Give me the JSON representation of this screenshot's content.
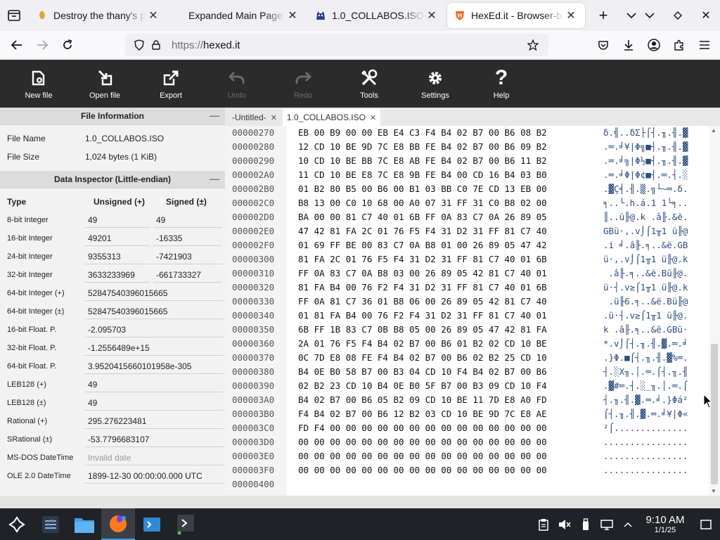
{
  "browser": {
    "tabs": [
      {
        "title": "Destroy the thany's pa",
        "icon": "orange-favicon",
        "active": false
      },
      {
        "title": "Expanded Main Page",
        "icon": "none",
        "active": false
      },
      {
        "title": "1.0_COLLABOS.ISO - ",
        "icon": "blue-creature-favicon",
        "active": false
      },
      {
        "title": "HexEd.it - Browser-b",
        "icon": "hexedit-shield-favicon",
        "active": true
      }
    ],
    "url_scheme": "https://",
    "url_host": "hexed.it"
  },
  "toolbar": {
    "items": [
      {
        "label": "New file",
        "icon": "new-file-icon",
        "disabled": false
      },
      {
        "label": "Open file",
        "icon": "open-file-icon",
        "disabled": false
      },
      {
        "label": "Export",
        "icon": "export-icon",
        "disabled": false
      },
      {
        "label": "Undo",
        "icon": "undo-icon",
        "disabled": true
      },
      {
        "label": "Redo",
        "icon": "redo-icon",
        "disabled": true
      },
      {
        "label": "Tools",
        "icon": "tools-icon",
        "disabled": false
      },
      {
        "label": "Settings",
        "icon": "gear-icon",
        "disabled": false
      },
      {
        "label": "Help",
        "icon": "help-icon",
        "disabled": false
      }
    ]
  },
  "file_info": {
    "header": "File Information",
    "name_label": "File Name",
    "name_value": "1.0_COLLABOS.ISO",
    "size_label": "File Size",
    "size_value": "1,024 bytes (1 KiB)"
  },
  "inspector": {
    "header": "Data Inspector (Little-endian)",
    "col_type": "Type",
    "col_unsigned": "Unsigned (+)",
    "col_signed": "Signed (±)",
    "rows": [
      {
        "type": "8-bit Integer",
        "unsigned": "49",
        "signed": "49"
      },
      {
        "type": "16-bit Integer",
        "unsigned": "49201",
        "signed": "-16335"
      },
      {
        "type": "24-bit Integer",
        "unsigned": "9355313",
        "signed": "-7421903"
      },
      {
        "type": "32-bit Integer",
        "unsigned": "3633233969",
        "signed": "-661733327"
      },
      {
        "type": "64-bit Integer (+)",
        "wide": "52847540396015665"
      },
      {
        "type": "64-bit Integer (±)",
        "wide": "52847540396015665"
      },
      {
        "type": "16-bit Float. P.",
        "wide": "-2.095703"
      },
      {
        "type": "32-bit Float. P.",
        "wide": "-1.2556489e+15"
      },
      {
        "type": "64-bit Float. P.",
        "wide": "3.9520415660101958e-305"
      },
      {
        "type": "LEB128 (+)",
        "wide": "49"
      },
      {
        "type": "LEB128 (±)",
        "wide": "49"
      },
      {
        "type": "Rational (+)",
        "wide": "295.276223481"
      },
      {
        "type": "SRational (±)",
        "wide": "-53.7796683107"
      },
      {
        "type": "MS-DOS DateTime",
        "wide": "Invalid date",
        "muted": true
      },
      {
        "type": "OLE 2.0 DateTime",
        "wide": "1899-12-30 00:00:00.000 UTC"
      }
    ]
  },
  "doctabs": [
    {
      "label": "-Untitled-",
      "active": false
    },
    {
      "label": "1.0_COLLABOS.ISO",
      "active": true
    }
  ],
  "hex": {
    "rows": [
      {
        "offset": "00000270",
        "hex": "EB 00 B9 00 00 EB E4 C3 F4 B4 02 B7 00 B6 08 B2",
        "ascii": "δ.╣..δΣ├⌠┤.╖.╢.▓"
      },
      {
        "offset": "00000280",
        "hex": "12 CD 10 BE 9D 7C E8 BB FE B4 02 B7 00 B6 09 B2",
        "ascii": ".═.╛¥|Φ╗■┤.╖.╢.▓"
      },
      {
        "offset": "00000290",
        "hex": "10 CD 10 BE BB 7C E8 AB FE B4 02 B7 00 B6 11 B2",
        "ascii": ".═.╛╗|Φ½■┤.╖.╢.▓"
      },
      {
        "offset": "000002A0",
        "hex": "11 CD 10 BE E8 7C E8 9B FE B4 00 CD 16 B4 03 B0",
        "ascii": ".═.╛Φ|Φ¢■┤.═.┤.░"
      },
      {
        "offset": "000002B0",
        "hex": "01 B2 80 B5 00 B6 00 B1 03 BB C0 7E CD 13 EB 00",
        "ascii": ".▓Ç╡.╢.▒.╗└~═.δ."
      },
      {
        "offset": "000002C0",
        "hex": "B8 13 00 C0 10 68 00 A0 07 31 FF 31 C0 B8 02 00",
        "ascii": "╕..└.h.á.1 1└╕.."
      },
      {
        "offset": "000002D0",
        "hex": "BA 00 00 81 C7 40 01 6B FF 0A 83 C7 0A 26 89 05",
        "ascii": "║..ü╟@.k .â╟.&ë."
      },
      {
        "offset": "000002E0",
        "hex": "47 42 81 FA 2C 01 76 F5 F4 31 D2 31 FF 81 C7 40",
        "ascii": "GBü·,.v⌡⌠1╥1 ü╟@"
      },
      {
        "offset": "000002F0",
        "hex": "01 69 FF BE 00 83 C7 0A B8 01 00 26 89 05 47 42",
        "ascii": ".i ╛.â╟.╕..&ë.GB"
      },
      {
        "offset": "00000300",
        "hex": "81 FA 2C 01 76 F5 F4 31 D2 31 FF 81 C7 40 01 6B",
        "ascii": "ü·,.v⌡⌠1╥1 ü╟@.k"
      },
      {
        "offset": "00000310",
        "hex": "FF 0A 83 C7 0A B8 03 00 26 89 05 42 81 C7 40 01",
        "ascii": " .â╟.╕..&ë.Bü╟@."
      },
      {
        "offset": "00000320",
        "hex": "81 FA B4 00 76 F2 F4 31 D2 31 FF 81 C7 40 01 6B",
        "ascii": "ü·┤.v≥⌠1╥1 ü╟@.k"
      },
      {
        "offset": "00000330",
        "hex": "FF 0A 81 C7 36 01 B8 06 00 26 89 05 42 81 C7 40",
        "ascii": " .ü╟6.╕..&ë.Bü╟@"
      },
      {
        "offset": "00000340",
        "hex": "01 81 FA B4 00 76 F2 F4 31 D2 31 FF 81 C7 40 01",
        "ascii": ".ü·┤.v≥⌠1╥1 ü╟@."
      },
      {
        "offset": "00000350",
        "hex": "6B FF 1B 83 C7 0B B8 05 00 26 89 05 47 42 81 FA",
        "ascii": "k .â╟.╕..&ë.GBü·"
      },
      {
        "offset": "00000360",
        "hex": "2A 01 76 F5 F4 B4 02 B7 00 B6 01 B2 02 CD 10 BE",
        "ascii": "*.v⌡⌠┤.╖.╢.▓.═.╛"
      },
      {
        "offset": "00000370",
        "hex": "0C 7D E8 08 FE F4 B4 02 B7 00 B6 02 B2 25 CD 10",
        "ascii": ".}Φ.■⌠┤.╖.╢.▓%═."
      },
      {
        "offset": "00000380",
        "hex": "B4 0E B0 58 B7 00 B3 04 CD 10 F4 B4 02 B7 00 B6",
        "ascii": "┤.░X╖.│.═.⌠┤.╖.╢"
      },
      {
        "offset": "00000390",
        "hex": "02 B2 23 CD 10 B4 0E B0 5F B7 00 B3 09 CD 10 F4",
        "ascii": ".▓#═.┤.░_╖.│.═.⌠"
      },
      {
        "offset": "000003A0",
        "hex": "B4 02 B7 00 B6 05 B2 09 CD 10 BE 11 7D E8 A0 FD",
        "ascii": "┤.╖.╢.▓.═.╛.}Φá²"
      },
      {
        "offset": "000003B0",
        "hex": "F4 B4 02 B7 00 B6 12 B2 03 CD 10 BE 9D 7C E8 AE",
        "ascii": "⌠┤.╖.╢.▓.═.╛¥|Φ«"
      },
      {
        "offset": "000003C0",
        "hex": "FD F4 00 00 00 00 00 00 00 00 00 00 00 00 00 00",
        "ascii": "²⌠.............."
      },
      {
        "offset": "000003D0",
        "hex": "00 00 00 00 00 00 00 00 00 00 00 00 00 00 00 00",
        "ascii": "................"
      },
      {
        "offset": "000003E0",
        "hex": "00 00 00 00 00 00 00 00 00 00 00 00 00 00 00 00",
        "ascii": "................"
      },
      {
        "offset": "000003F0",
        "hex": "00 00 00 00 00 00 00 00 00 00 00 00 00 00 00 00",
        "ascii": "................"
      },
      {
        "offset": "00000400",
        "hex": "",
        "ascii": ""
      }
    ]
  },
  "taskbar": {
    "clock_time": "9:10 AM",
    "clock_date": "1/1/25"
  },
  "colors": {
    "toolbar_bg": "#2b2b2b",
    "ascii_color": "#2a4e7e",
    "taskbar_bg": "#1f2226",
    "accent": "#3d9ee8"
  }
}
